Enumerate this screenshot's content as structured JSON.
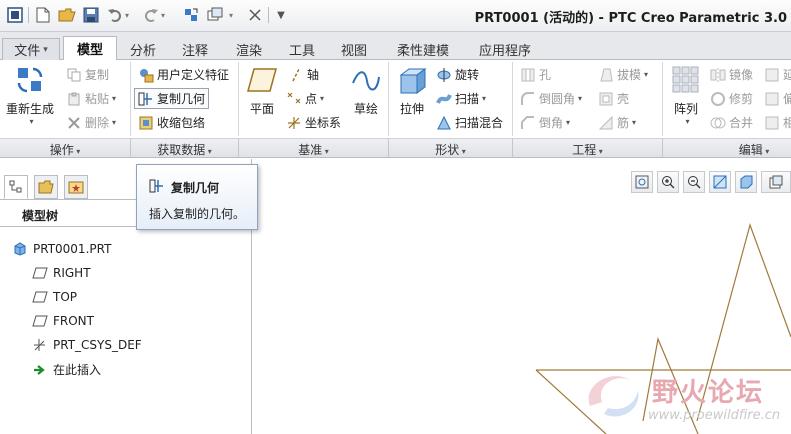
{
  "window": {
    "title": "PRT0001 (活动的) - PTC Creo Parametric 3.0"
  },
  "tabs": [
    {
      "label": "文件"
    },
    {
      "label": "模型"
    },
    {
      "label": "分析"
    },
    {
      "label": "注释"
    },
    {
      "label": "渲染"
    },
    {
      "label": "工具"
    },
    {
      "label": "视图"
    },
    {
      "label": "柔性建模"
    },
    {
      "label": "应用程序"
    }
  ],
  "ribbon": {
    "operations": {
      "regenerate": "重新生成",
      "copy": "复制",
      "paste": "粘贴",
      "delete": "删除"
    },
    "get_data": {
      "udf": "用户定义特征",
      "copy_geometry": "复制几何",
      "shrinkwrap": "收缩包络"
    },
    "datum": {
      "plane": "平面",
      "axis": "轴",
      "point": "点",
      "csys": "坐标系",
      "sketch": "草绘"
    },
    "shapes": {
      "extrude": "拉伸",
      "revolve": "旋转",
      "sweep": "扫描",
      "swept_blend": "扫描混合"
    },
    "engineering": {
      "hole": "孔",
      "round": "倒圆角",
      "chamfer": "倒角",
      "draft": "拔模",
      "shell": "壳",
      "rib": "筋"
    },
    "editing": {
      "pattern": "阵列",
      "mirror": "镜像",
      "trim": "修剪",
      "merge": "合并",
      "extend": "延",
      "offset": "偏",
      "thicken": "相"
    }
  },
  "groups": {
    "operations": "操作",
    "get_data": "获取数据",
    "datum": "基准",
    "shapes": "形状",
    "engineering": "工程",
    "editing": "编辑"
  },
  "tooltip": {
    "title": "复制几何",
    "description": "插入复制的几何。"
  },
  "model_tree": {
    "title": "模型树",
    "items": [
      {
        "label": "PRT0001.PRT",
        "icon": "part-icon"
      },
      {
        "label": "RIGHT",
        "icon": "datum-plane-icon"
      },
      {
        "label": "TOP",
        "icon": "datum-plane-icon"
      },
      {
        "label": "FRONT",
        "icon": "datum-plane-icon"
      },
      {
        "label": "PRT_CSYS_DEF",
        "icon": "csys-icon"
      },
      {
        "label": "在此插入",
        "icon": "insert-here-arrow-icon"
      }
    ]
  },
  "watermark": {
    "text": "野火论坛",
    "url": "www.proewildfire.cn"
  },
  "colors": {
    "sketch_line": "#a07a3c",
    "accent_blue": "#2b6fb8",
    "watermark": "#e7a8b0"
  }
}
